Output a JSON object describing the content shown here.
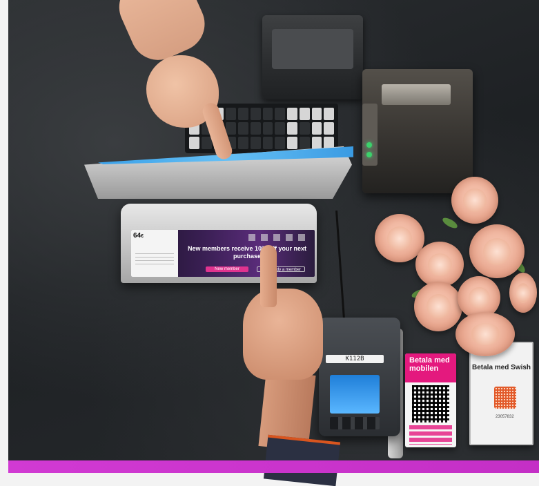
{
  "photo": {
    "subject": "point-of-sale checkout counter",
    "customer_display": {
      "amount": "64",
      "amount_unit": "€",
      "promo_text": "New members receive 10% off your next purchase",
      "new_member_button": "New member",
      "login_button": "I'm already a member"
    },
    "card_terminal": {
      "label": "K112B"
    },
    "pink_sign": {
      "title": "Betala med mobilen"
    },
    "swish_sign": {
      "title": "Betala med Swish",
      "number": "23057832"
    },
    "colors": {
      "counter": "#262a2d",
      "magenta_edge": "#cf36d1",
      "pink_sign": "#e4197e",
      "roses": "#f1b9a3"
    }
  }
}
